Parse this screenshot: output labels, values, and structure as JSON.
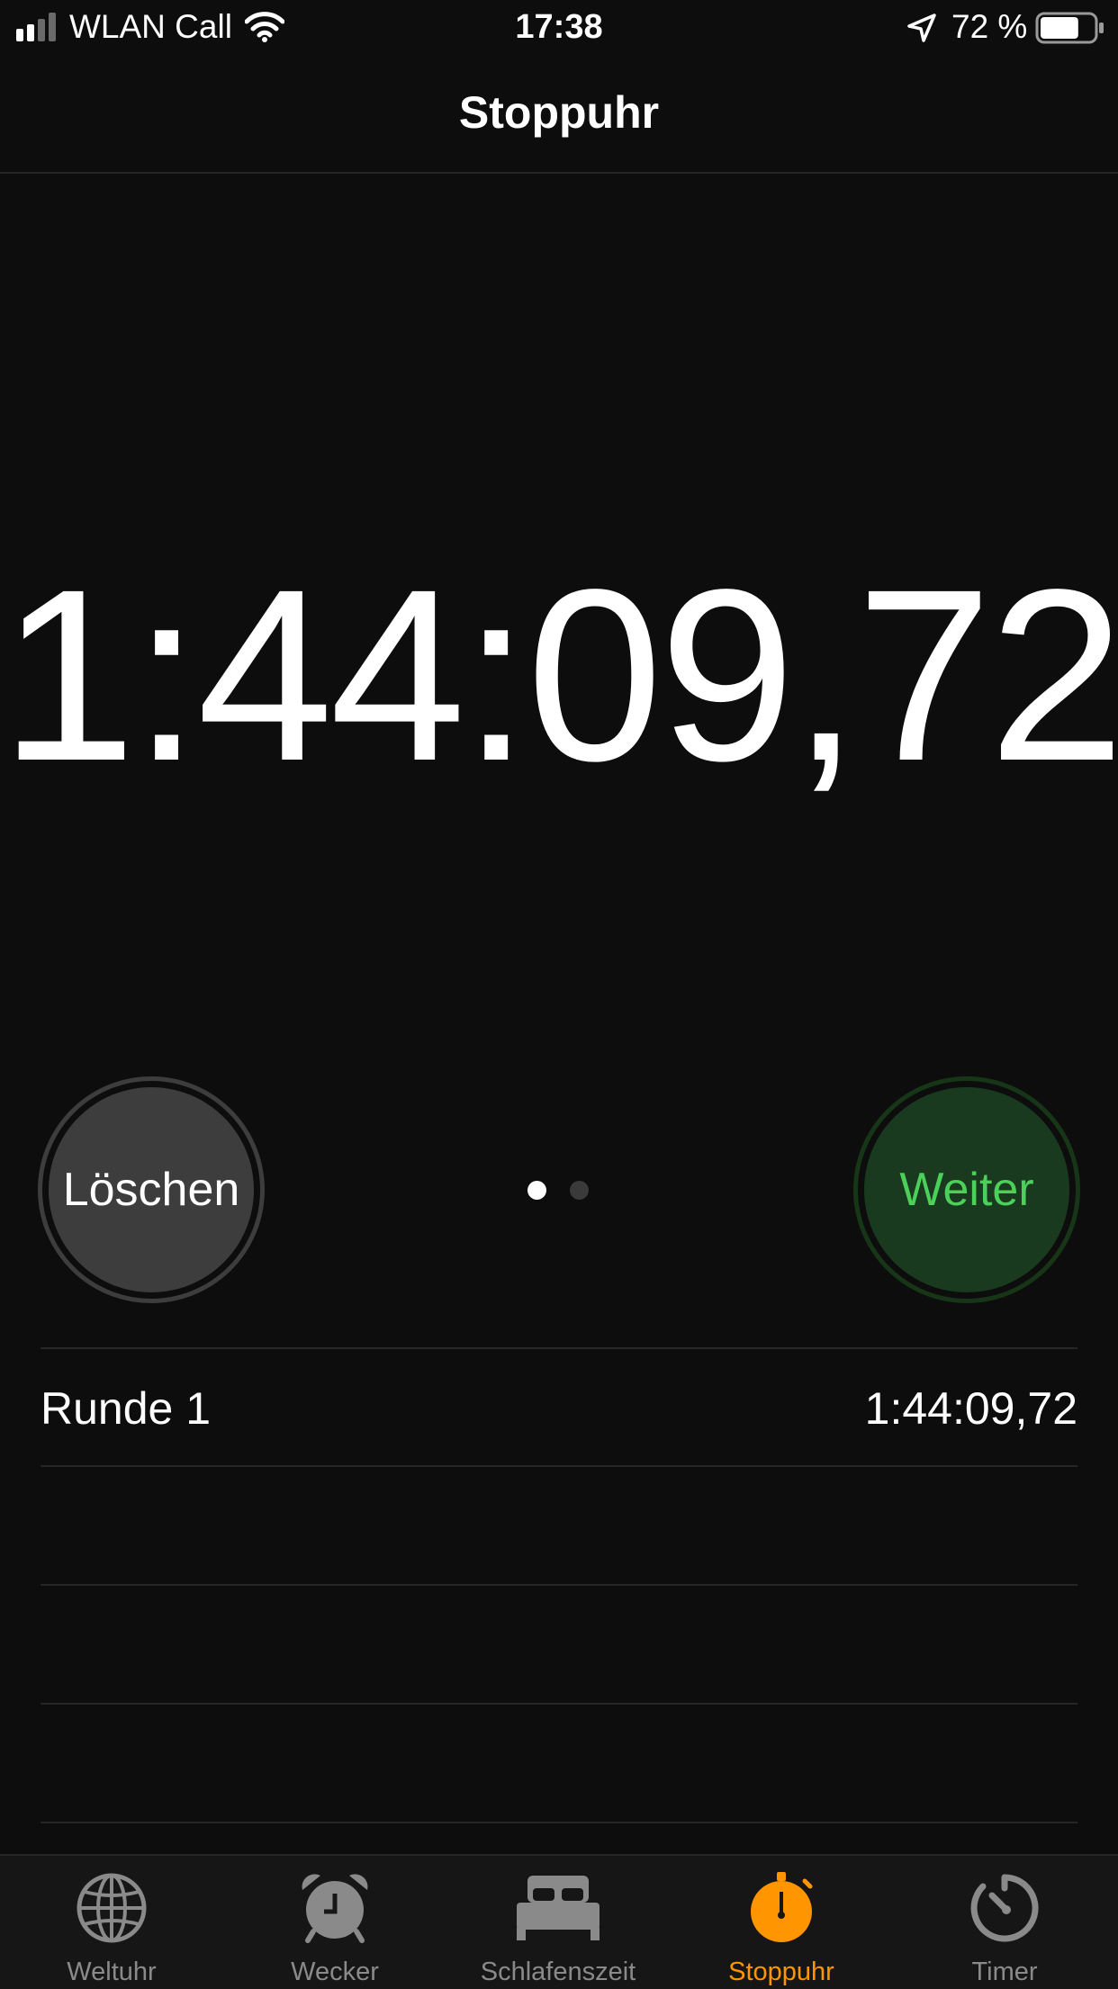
{
  "status_bar": {
    "carrier": "WLAN Call",
    "time": "17:38",
    "battery_percent": "72 %",
    "battery_level": 0.72
  },
  "nav": {
    "title": "Stoppuhr"
  },
  "stopwatch": {
    "elapsed": "1:44:09,72",
    "left_button": "Löschen",
    "right_button": "Weiter",
    "page_count": 2,
    "active_page": 1
  },
  "laps": [
    {
      "label": "Runde 1",
      "time": "1:44:09,72"
    }
  ],
  "colors": {
    "accent": "#ff9500",
    "start_green": "#4bd15a",
    "start_green_bg": "#1a3a1f",
    "reset_bg": "#3d3d3d",
    "background": "#0d0d0d"
  },
  "tabs": [
    {
      "label": "Weltuhr",
      "icon": "globe-icon",
      "active": false
    },
    {
      "label": "Wecker",
      "icon": "alarm-clock-icon",
      "active": false
    },
    {
      "label": "Schlafenszeit",
      "icon": "bed-icon",
      "active": false
    },
    {
      "label": "Stoppuhr",
      "icon": "stopwatch-icon",
      "active": true
    },
    {
      "label": "Timer",
      "icon": "timer-icon",
      "active": false
    }
  ]
}
